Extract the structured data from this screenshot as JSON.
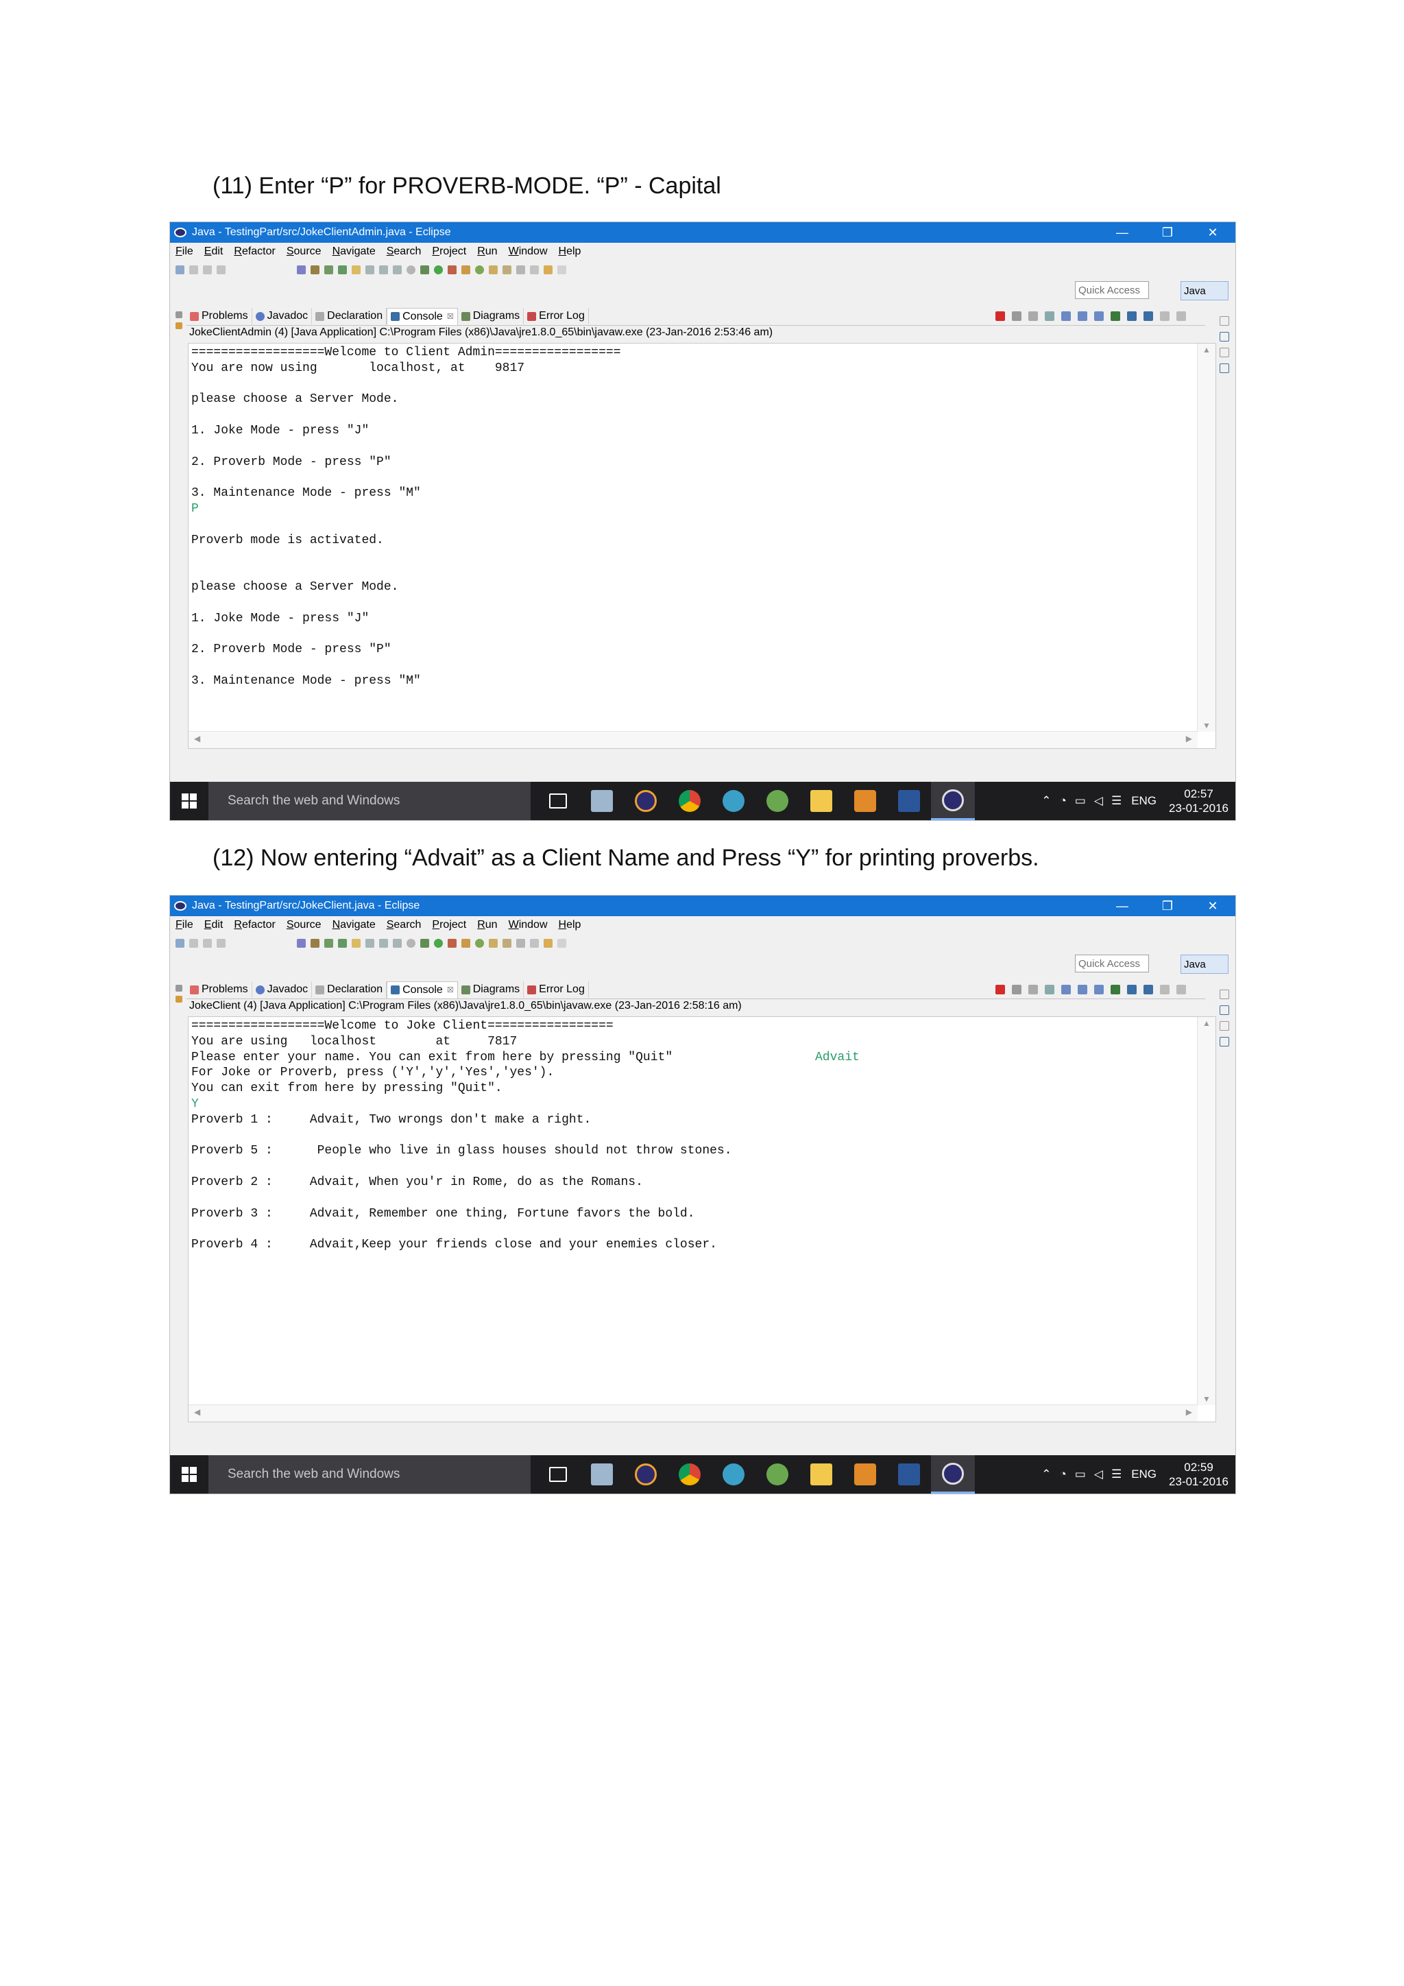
{
  "captions": {
    "first": "(11) Enter “P” for PROVERB-MODE. “P” - Capital",
    "second": "(12) Now entering “Advait” as a Client Name and Press “Y” for printing proverbs."
  },
  "eclipse": {
    "menu": [
      "File",
      "Edit",
      "Refactor",
      "Source",
      "Navigate",
      "Search",
      "Project",
      "Run",
      "Window",
      "Help"
    ],
    "quick_access_placeholder": "Quick Access",
    "perspective_label": "Java",
    "tabs": [
      "Problems",
      "Javadoc",
      "Declaration",
      "Console",
      "Diagrams",
      "Error Log"
    ],
    "tab_close": "☒"
  },
  "window_controls": {
    "minimize": "—",
    "restore": "❐",
    "close": "✕"
  },
  "screenshot1": {
    "window_title": "Java - TestingPart/src/JokeClientAdmin.java - Eclipse",
    "process": "JokeClientAdmin (4) [Java Application] C:\\Program Files (x86)\\Java\\jre1.8.0_65\\bin\\javaw.exe (23-Jan-2016 2:53:46 am)",
    "lines": [
      "==================Welcome to Client Admin=================",
      "You are now using       localhost, at    9817",
      "",
      "please choose a Server Mode.",
      "",
      "1. Joke Mode - press \"J\"",
      "",
      "2. Proverb Mode - press \"P\"",
      "",
      "3. Maintenance Mode - press \"M\""
    ],
    "user_input": "P",
    "lines_after": [
      "",
      "Proverb mode is activated.",
      "",
      "",
      "please choose a Server Mode.",
      "",
      "1. Joke Mode - press \"J\"",
      "",
      "2. Proverb Mode - press \"P\"",
      "",
      "3. Maintenance Mode - press \"M\""
    ],
    "taskbar": {
      "search_placeholder": "Search the web and Windows",
      "lang": "ENG",
      "time": "02:57",
      "date": "23-01-2016"
    }
  },
  "screenshot2": {
    "window_title": "Java - TestingPart/src/JokeClient.java - Eclipse",
    "process": "JokeClient (4) [Java Application] C:\\Program Files (x86)\\Java\\jre1.8.0_65\\bin\\javaw.exe (23-Jan-2016 2:58:16 am)",
    "lines": [
      "==================Welcome to Joke Client=================",
      "You are using   localhost        at     7817",
      "Please enter your name. You can exit from here by pressing \"Quit\"",
      "For Joke or Proverb, press ('Y','y','Yes','yes').",
      "You can exit from here by pressing \"Quit\"."
    ],
    "name_input": "Advait",
    "user_input": "Y",
    "proverbs": [
      "Proverb 1 :     Advait, Two wrongs don't make a right.",
      "",
      "Proverb 5 :      People who live in glass houses should not throw stones.",
      "",
      "Proverb 2 :     Advait, When you'r in Rome, do as the Romans.",
      "",
      "Proverb 3 :     Advait, Remember one thing, Fortune favors the bold.",
      "",
      "Proverb 4 :     Advait,Keep your friends close and your enemies closer."
    ],
    "taskbar": {
      "search_placeholder": "Search the web and Windows",
      "lang": "ENG",
      "time": "02:59",
      "date": "23-01-2016"
    }
  },
  "tray_icons": [
    "chevron-up-icon",
    "wifi-icon",
    "battery-icon",
    "volume-icon",
    "notifications-icon"
  ],
  "taskbar_apps": [
    "task-view",
    "notes-app",
    "eclipse-app",
    "chrome-app",
    "network-app",
    "android-app",
    "explorer-app",
    "sublime-app",
    "word-app",
    "eclipse-active-app"
  ],
  "colors": {
    "title_blue": "#1574d4",
    "input_green": "#2a9d6a",
    "taskbar": "#1d1d1f"
  }
}
